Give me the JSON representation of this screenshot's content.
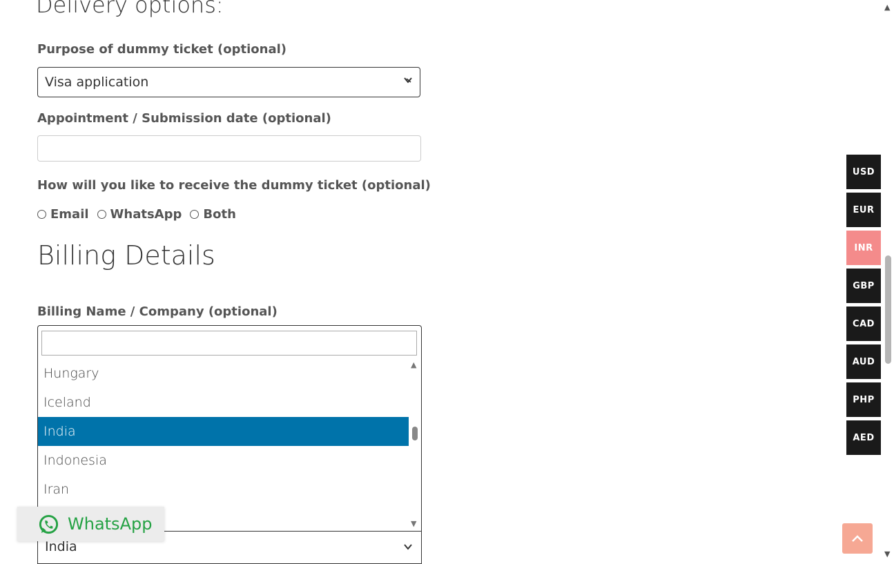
{
  "delivery": {
    "heading": "Delivery options:",
    "purpose_label": "Purpose of dummy ticket (optional)",
    "purpose_value": "Visa application",
    "date_label": "Appointment / Submission date (optional)",
    "date_value": "",
    "receive_label": "How will you like to receive the dummy ticket (optional)",
    "receive_options": [
      "Email",
      "WhatsApp",
      "Both"
    ]
  },
  "billing": {
    "heading": "Billing Details",
    "name_label": "Billing Name / Company (optional)",
    "country_search_value": "",
    "country_options": [
      "Hungary",
      "Iceland",
      "India",
      "Indonesia",
      "Iran"
    ],
    "country_selected": "India"
  },
  "whatsapp": {
    "label": "WhatsApp",
    "color": "#25a244"
  },
  "currencies": {
    "items": [
      "USD",
      "EUR",
      "INR",
      "GBP",
      "CAD",
      "AUD",
      "PHP",
      "AED"
    ],
    "active": "INR",
    "active_color": "#f48b8b"
  },
  "colors": {
    "selected": "#0073aa",
    "top_button": "#f6a894"
  }
}
